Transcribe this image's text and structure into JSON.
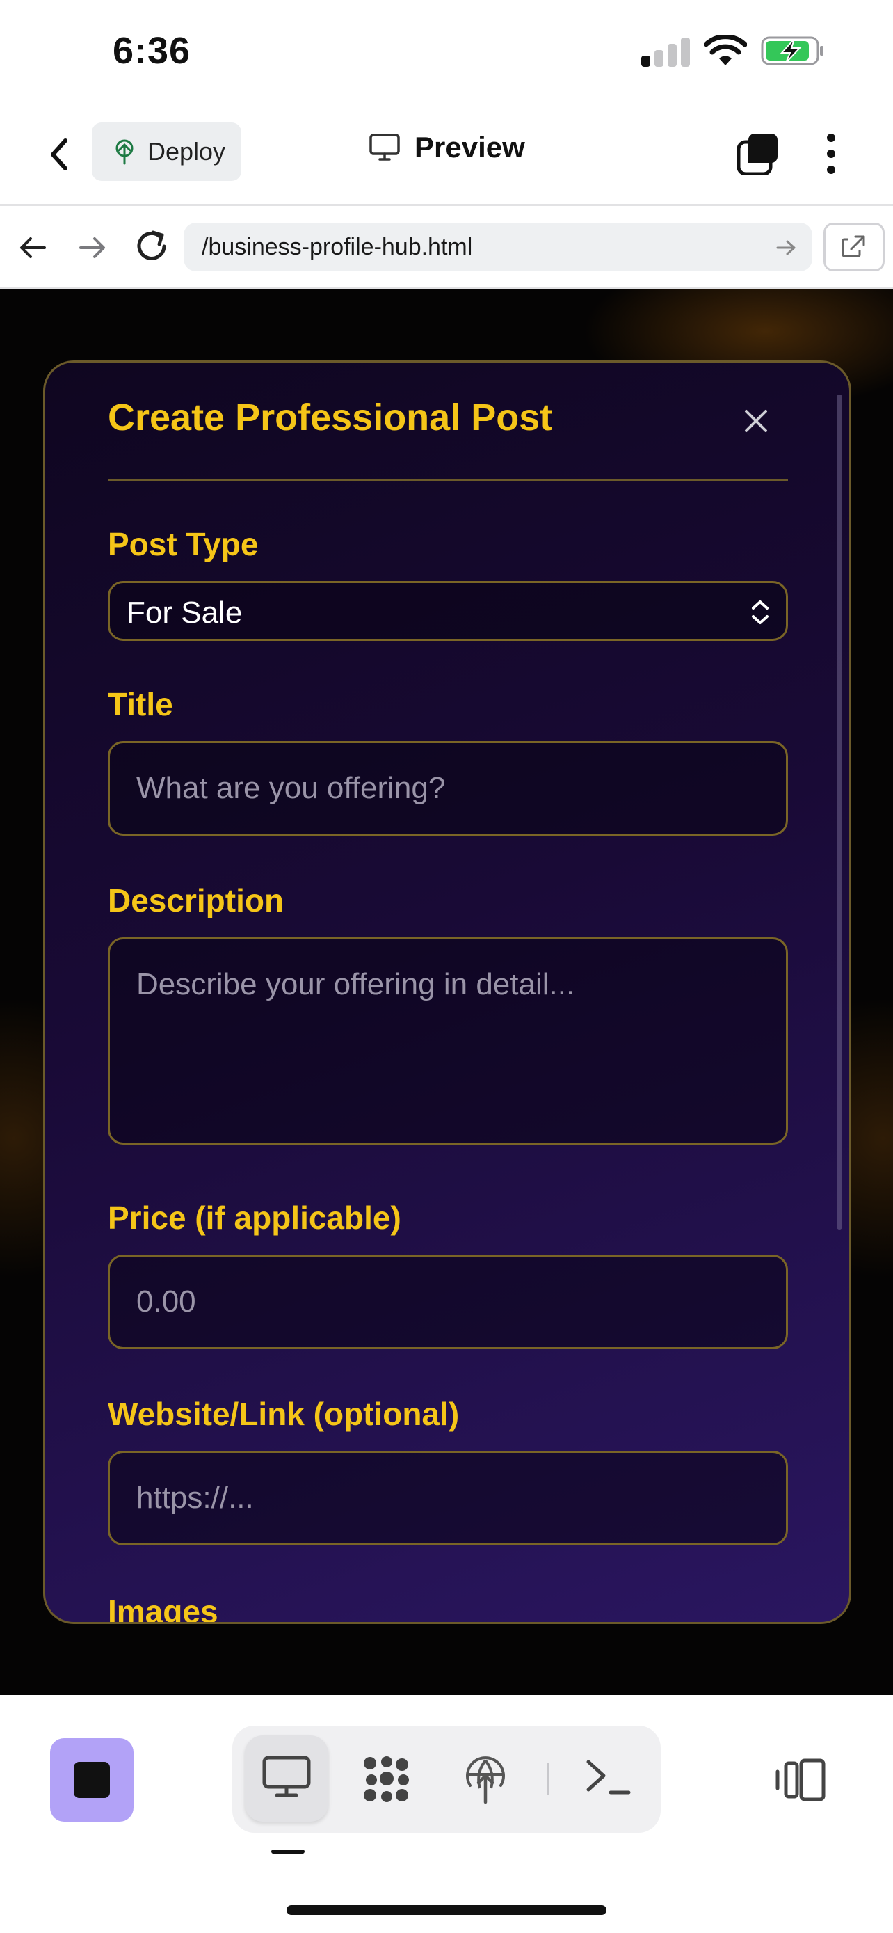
{
  "status_bar": {
    "time": "6:36",
    "signal_bars_active": 1,
    "battery_charging": true
  },
  "app_header": {
    "deploy_label": "Deploy",
    "preview_label": "Preview"
  },
  "browser": {
    "url": "/business-profile-hub.html"
  },
  "modal": {
    "title": "Create Professional Post",
    "fields": {
      "post_type": {
        "label": "Post Type",
        "value": "For Sale"
      },
      "title": {
        "label": "Title",
        "placeholder": "What are you offering?"
      },
      "description": {
        "label": "Description",
        "placeholder": "Describe your offering in detail..."
      },
      "price": {
        "label": "Price (if applicable)",
        "placeholder": "0.00"
      },
      "website": {
        "label": "Website/Link (optional)",
        "placeholder": "https://..."
      },
      "images": {
        "label": "Images"
      }
    }
  },
  "colors": {
    "accent_gold": "#f5c518",
    "modal_bg": "#190a36",
    "field_border": "#7a6526",
    "stop_button": "#b2a2f7"
  },
  "bottom_toolbar": {
    "icons": [
      "stop-icon",
      "desktop-icon",
      "apps-icon",
      "deploy-icon",
      "terminal-icon",
      "panels-icon"
    ],
    "active_tab": "desktop"
  }
}
